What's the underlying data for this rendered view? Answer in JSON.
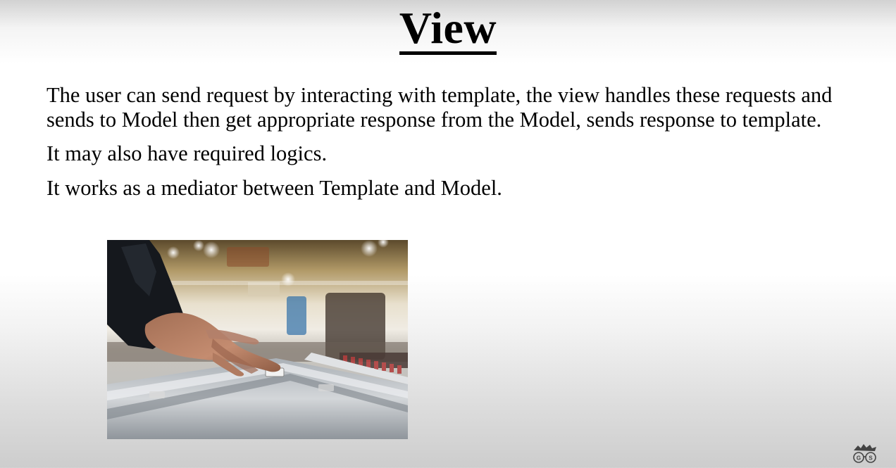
{
  "slide": {
    "title": "View",
    "paragraphs": [
      "The user can send request by interacting with template, the view handles these requests and sends to Model then get appropriate response from the Model, sends response to template.",
      "It may also have required logics.",
      "It works as a mediator between Template and Model."
    ]
  },
  "logo": {
    "text": "GS"
  },
  "icons": {
    "photo": "mixing-console-photo",
    "logo": "geeky-shows-logo-icon"
  }
}
